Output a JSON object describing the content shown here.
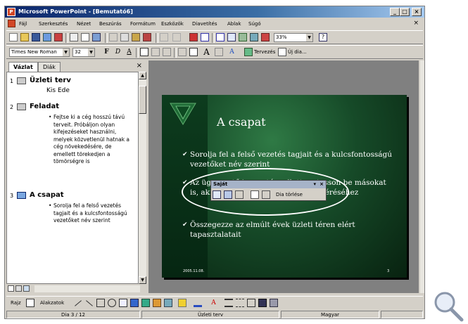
{
  "titlebar": {
    "title": "Microsoft PowerPoint - [Bemutató6]",
    "buttons": [
      "_",
      "□",
      "×"
    ]
  },
  "menubar": {
    "items": [
      "Fájl",
      "Szerkesztés",
      "Nézet",
      "Beszúrás",
      "Formátum",
      "Eszközök",
      "Diavetítés",
      "Ablak",
      "Súgó"
    ],
    "close": "×"
  },
  "standard_toolbar": {
    "zoom": "33%"
  },
  "formatting_toolbar": {
    "font": "Times New Roman",
    "size": "32",
    "bold": "F",
    "italic": "D",
    "underline": "A",
    "design_label": "Tervezés",
    "new_slide_label": "Új dia..."
  },
  "left_pane": {
    "tabs": [
      "Vázlat",
      "Diák"
    ],
    "close": "×",
    "slides": [
      {
        "num": "1",
        "title": "Üzleti terv",
        "sub": "Kis Ede",
        "bullets": []
      },
      {
        "num": "2",
        "title": "Feladat",
        "sub": "",
        "bullets": [
          "Fejtse ki a cég hosszú távú terveit. Próbáljon olyan kifejezéseket használni, melyek közvetlenül hatnak a cég növekedésére, de emellett törekedjen a tömörségre is"
        ]
      },
      {
        "num": "3",
        "title": "A csapat",
        "sub": "",
        "bullets": [
          "Sorolja fel a felső vezetés tagjait és a kulcsfontosságú vezetőket név szerint"
        ]
      }
    ]
  },
  "slide": {
    "title": "A csapat",
    "bullets": [
      "Sorolja fel a felső vezetés tagjait és a kulcsfontosságú vezetőket név szerint",
      "Az ügyvezető igazgató mellett mutasson be másokat is, akik kulcsfontosságúak a siker eléréséhez",
      "Összegezze az elmúlt évek üzleti téren elért tapasztalatait"
    ],
    "footer_left": "2005.11.08.",
    "footer_right": "3"
  },
  "float_toolbar": {
    "title": "Saját",
    "edit_label": "Dia törlése"
  },
  "drawing_toolbar": {
    "draw_label": "Rajz",
    "autoshapes_label": "Alakzatok"
  },
  "statusbar": {
    "slide": "Dia 3 / 12",
    "design": "Üzleti terv",
    "language": "Magyar"
  }
}
